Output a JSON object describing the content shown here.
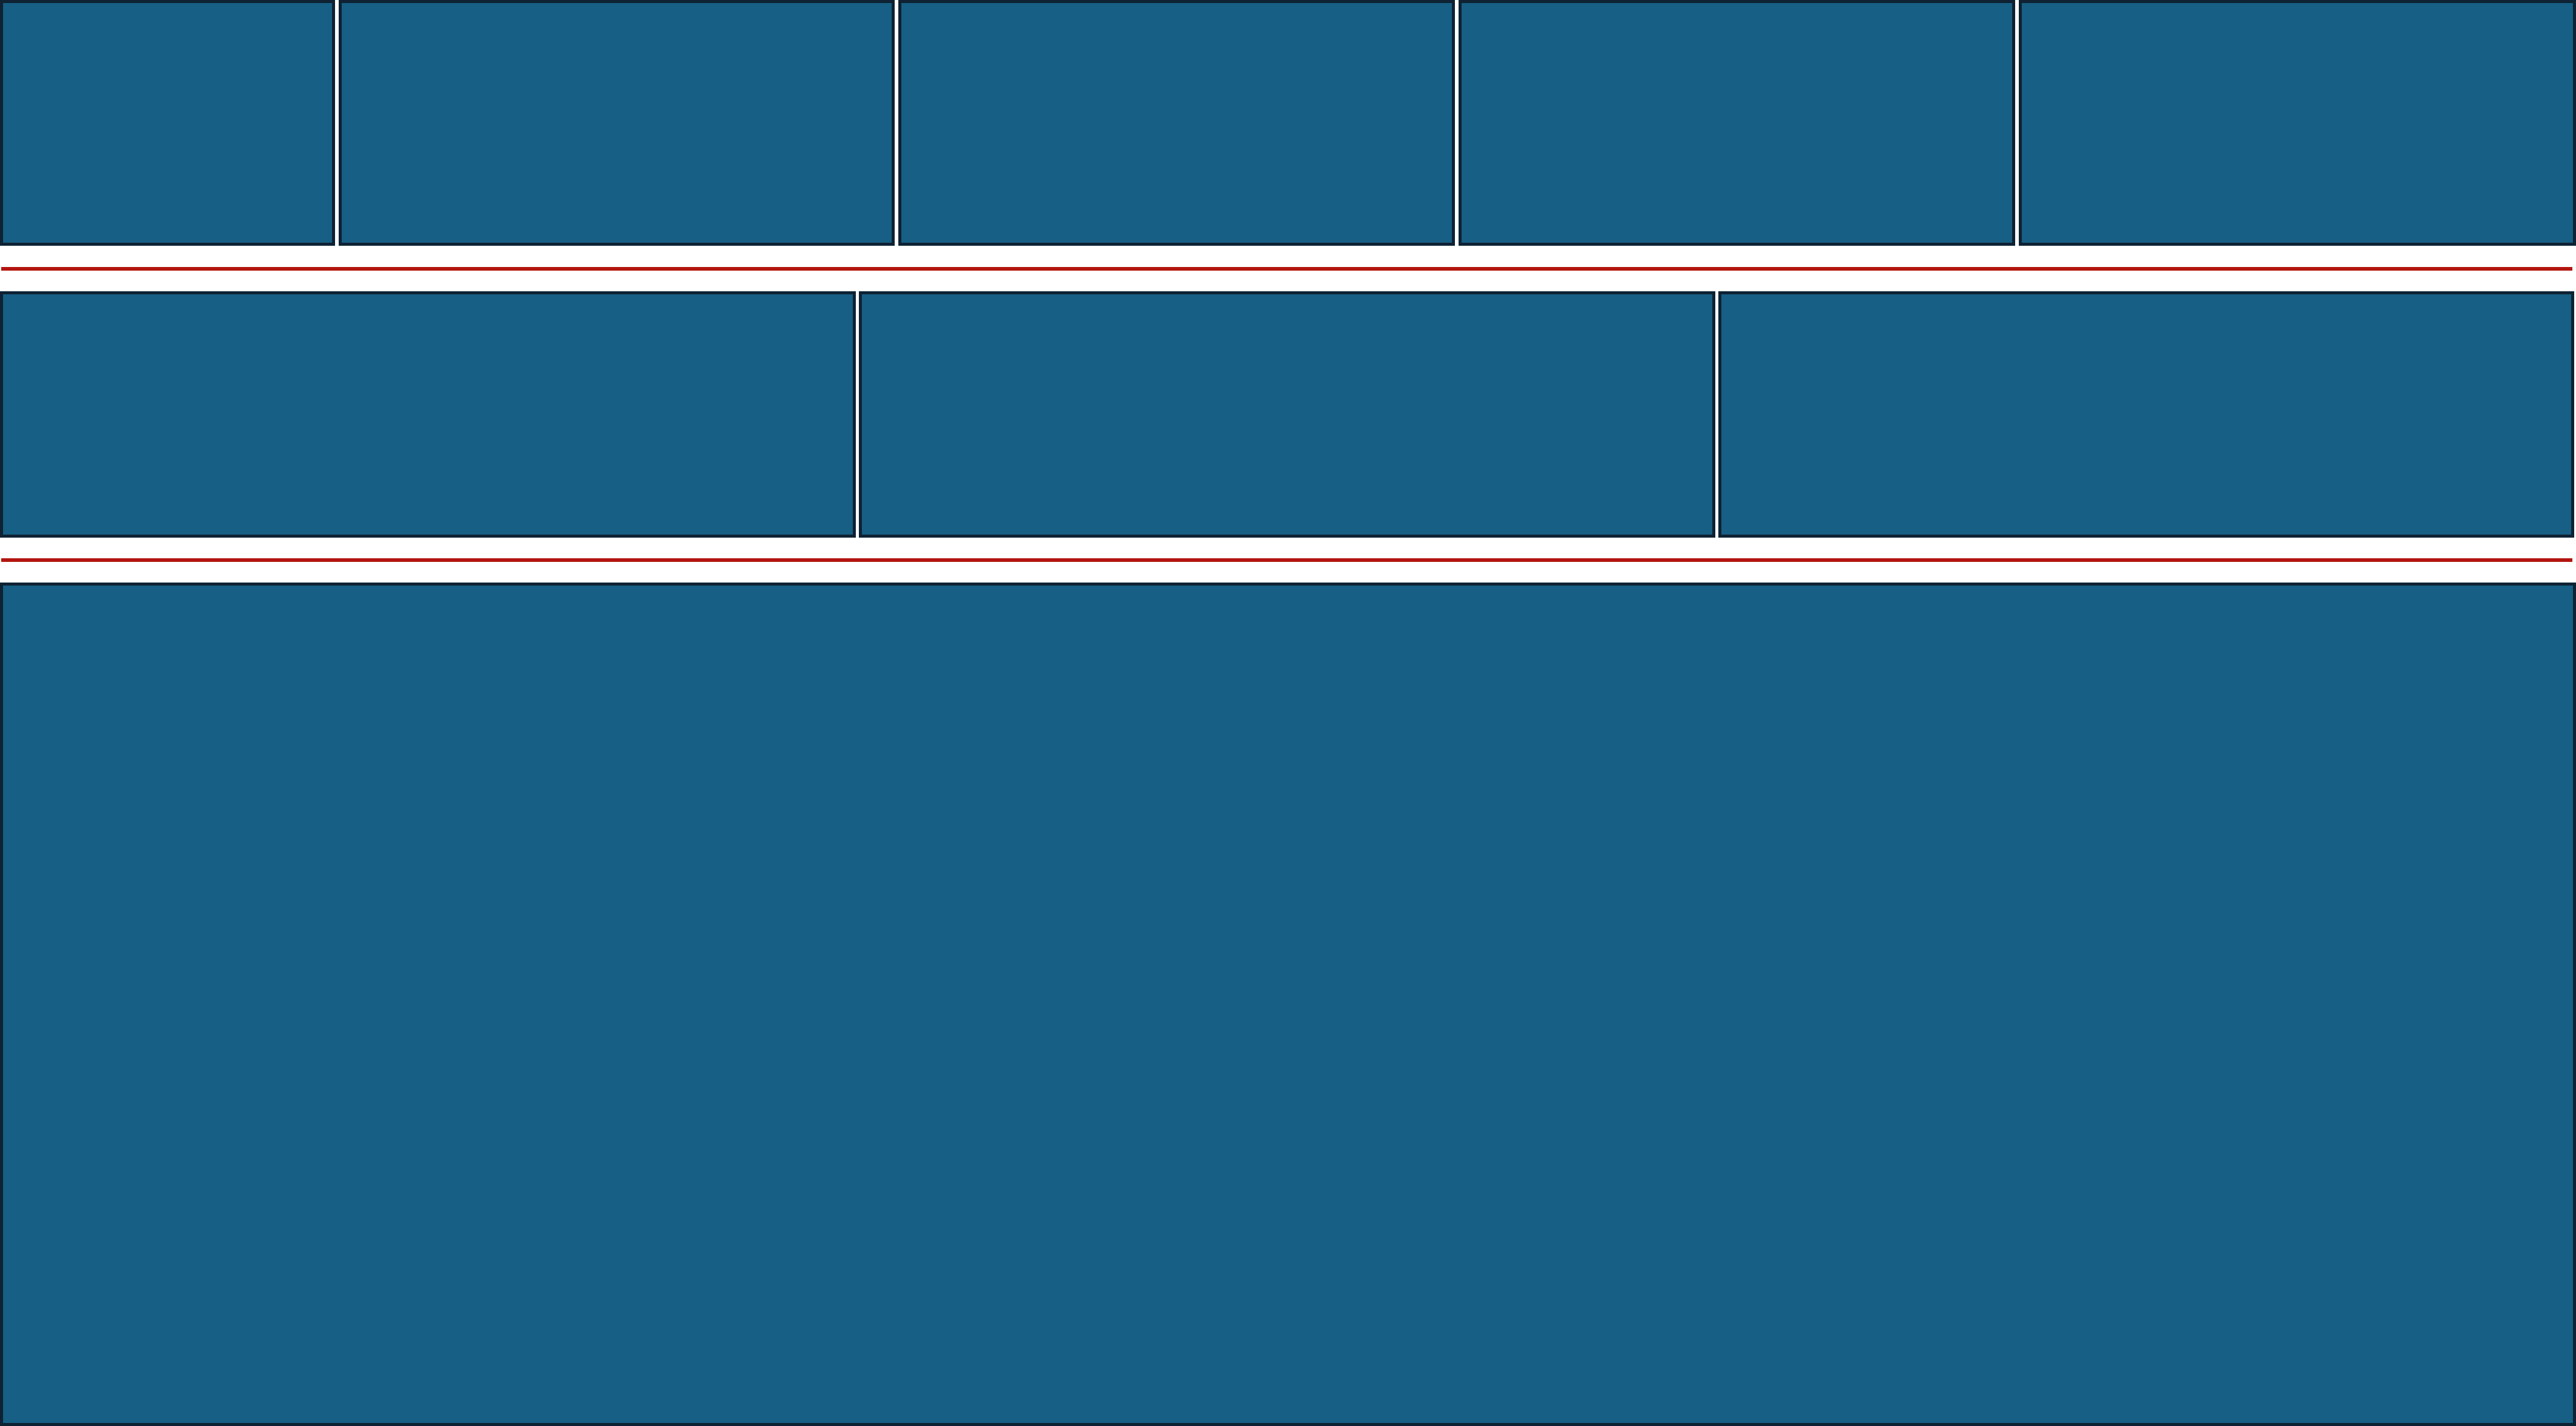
{
  "colors": {
    "block_fill": "#175f84",
    "block_border": "#0e2233",
    "divider": "#b3150f",
    "background": "#ffffff"
  },
  "rows": [
    {
      "block_count": 5
    },
    {
      "block_count": 3
    },
    {
      "block_count": 1
    }
  ],
  "divider_count": 2
}
